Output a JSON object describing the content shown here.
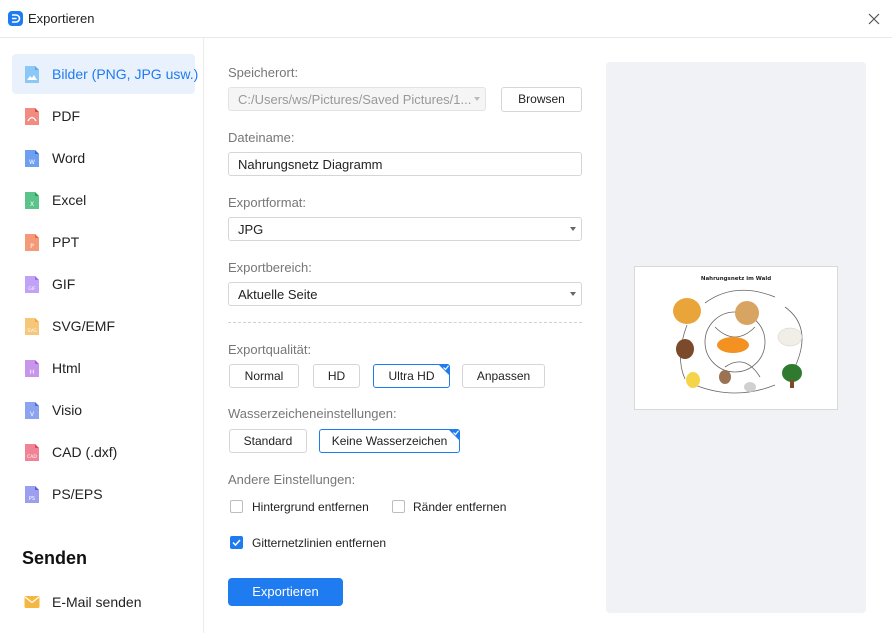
{
  "window": {
    "title": "Exportieren"
  },
  "sidebar": {
    "items": [
      {
        "label": "Bilder (PNG, JPG usw.)",
        "icon": "image-file-icon",
        "color": "#3aa0f0",
        "tag": "",
        "active": true
      },
      {
        "label": "PDF",
        "icon": "pdf-file-icon",
        "color": "#e85a4f",
        "tag": ""
      },
      {
        "label": "Word",
        "icon": "word-file-icon",
        "color": "#2f6fd6",
        "tag": "W"
      },
      {
        "label": "Excel",
        "icon": "excel-file-icon",
        "color": "#22a05a",
        "tag": "X"
      },
      {
        "label": "PPT",
        "icon": "ppt-file-icon",
        "color": "#f0673b",
        "tag": "P"
      },
      {
        "label": "GIF",
        "icon": "gif-file-icon",
        "color": "#9b6cf0",
        "tag": "GIF"
      },
      {
        "label": "SVG/EMF",
        "icon": "svg-file-icon",
        "color": "#f2a93b",
        "tag": "SVG"
      },
      {
        "label": "Html",
        "icon": "html-file-icon",
        "color": "#a65fd8",
        "tag": "H"
      },
      {
        "label": "Visio",
        "icon": "visio-file-icon",
        "color": "#4d6fe0",
        "tag": "V"
      },
      {
        "label": "CAD (.dxf)",
        "icon": "cad-file-icon",
        "color": "#e8455a",
        "tag": "CAD"
      },
      {
        "label": "PS/EPS",
        "icon": "ps-file-icon",
        "color": "#5b5fd6",
        "tag": "PS"
      }
    ],
    "send_title": "Senden",
    "send_items": [
      {
        "label": "E-Mail senden",
        "icon": "mail-icon",
        "color": "#f4b740"
      }
    ]
  },
  "form": {
    "location_label": "Speicherort:",
    "location_value": "C:/Users/ws/Pictures/Saved Pictures/1...",
    "browse_label": "Browsen",
    "filename_label": "Dateiname:",
    "filename_value": "Nahrungsnetz Diagramm",
    "format_label": "Exportformat:",
    "format_value": "JPG",
    "range_label": "Exportbereich:",
    "range_value": "Aktuelle Seite",
    "quality_label": "Exportqualität:",
    "quality_options": [
      "Normal",
      "HD",
      "Ultra HD",
      "Anpassen"
    ],
    "quality_selected": "Ultra HD",
    "watermark_label": "Wasserzeicheneinstellungen:",
    "watermark_options": [
      "Standard",
      "Keine Wasserzeichen"
    ],
    "watermark_selected": "Keine Wasserzeichen",
    "other_label": "Andere Einstellungen:",
    "options": [
      {
        "label": "Hintergrund entfernen",
        "checked": false
      },
      {
        "label": "Ränder entfernen",
        "checked": false
      },
      {
        "label": "Gitternetzlinien entfernen",
        "checked": true
      }
    ],
    "export_button": "Exportieren"
  },
  "preview": {
    "title": "Nahrungsnetz im Wald",
    "accent": "#1f7cf0"
  }
}
